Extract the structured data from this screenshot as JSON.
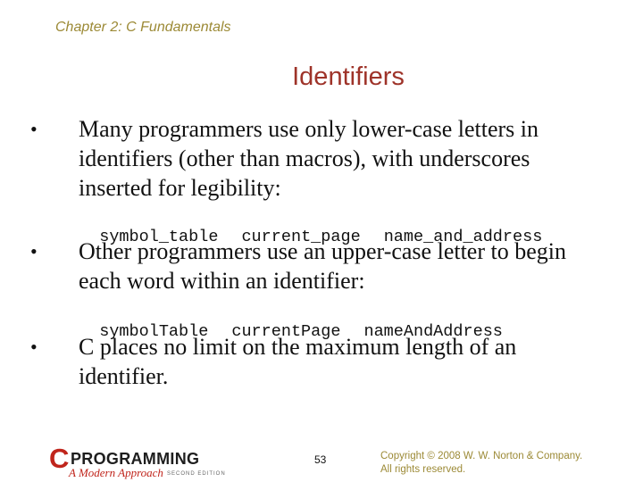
{
  "header": {
    "chapter": "Chapter 2: C Fundamentals"
  },
  "slide": {
    "title": "Identifiers",
    "bullets": [
      {
        "text": "Many programmers use only lower-case letters in identifiers (other than macros), with underscores inserted for legibility:"
      },
      {
        "text": "Other programmers use an upper-case letter to begin each word within an identifier:"
      },
      {
        "text": "C places no limit on the maximum length of an identifier."
      }
    ],
    "examples_lower": [
      "symbol_table",
      "current_page",
      "name_and_address"
    ],
    "examples_camel": [
      "symbolTable",
      "currentPage",
      "nameAndAddress"
    ],
    "bullet_glyph": "•"
  },
  "footer": {
    "logo": {
      "letter": "C",
      "word": "PROGRAMMING",
      "subtitle": "A Modern Approach",
      "edition": "SECOND EDITION"
    },
    "page_number": "53",
    "copyright_line1": "Copyright © 2008 W. W. Norton & Company.",
    "copyright_line2": "All rights reserved."
  },
  "colors": {
    "header": "#9c8a36",
    "title": "#9e3329",
    "logo_red": "#c0251c"
  }
}
